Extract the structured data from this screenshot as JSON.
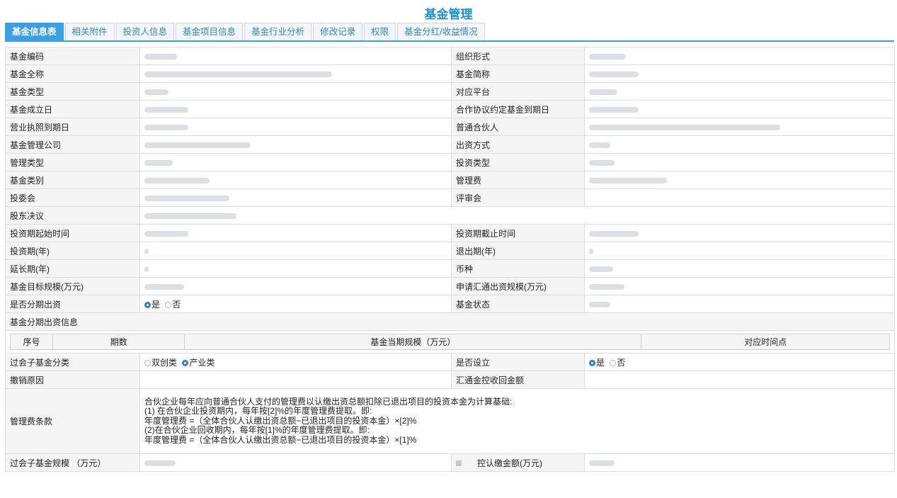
{
  "title": "基金管理",
  "tabs": [
    {
      "label": "基金信息表",
      "active": true
    },
    {
      "label": "相关附件"
    },
    {
      "label": "投资人信息"
    },
    {
      "label": "基金项目信息"
    },
    {
      "label": "基金行业分析"
    },
    {
      "label": "修改记录"
    },
    {
      "label": "权限"
    },
    {
      "label": "基金分红/收益情况"
    }
  ],
  "fields": {
    "fund_code": "基金编码",
    "org_form": "组织形式",
    "full_name": "基金全称",
    "short_name": "基金简称",
    "fund_type": "基金类型",
    "platform": "对应平台",
    "setup_date": "基金成立日",
    "agreement_expiry": "合作协议约定基金到期日",
    "license_expiry": "营业执照到期日",
    "gp": "普通合伙人",
    "manager": "基金管理公司",
    "contribution_method": "出资方式",
    "mgmt_type": "管理类型",
    "invest_type": "投资类型",
    "fund_category": "基金类别",
    "mgmt_fee": "管理费",
    "invest_committee": "投委会",
    "review_committee": "评审会",
    "shareholder_resolution": "股东决议",
    "invest_start": "投资期起始时间",
    "invest_end": "投资期截止时间",
    "invest_period": "投资期(年)",
    "exit_period": "退出期(年)",
    "extension_period": "延长期(年)",
    "currency": "币种",
    "target_scale": "基金目标规模(万元)",
    "apply_scale": "申请汇通出资规模(万元)",
    "installment": "是否分期出资",
    "fund_status": "基金状态",
    "installment_info": "基金分期出资信息",
    "sub_fund_class": "过会子基金分类",
    "is_established": "是否设立",
    "cancel_reason": "撤销原因",
    "recover_amount": "汇通金控收回金额",
    "fee_clause": "管理费条款",
    "sub_fund_scale": "过会子基金规模 （万元）",
    "confirmed_amount": "控认缴金额(万元)"
  },
  "radios": {
    "yes": "是",
    "no": "否",
    "dual": "双创类",
    "industry": "产业类"
  },
  "sub_table": {
    "headers": [
      "序号",
      "期数",
      "基金当期规模（万元）",
      "对应时间点"
    ]
  },
  "fee_clause_text": [
    "合伙企业每年应向普通合伙人支付的管理费以认缴出资总额扣除已退出项目的投资本金为计算基础:",
    "(1) 在合伙企业投资期内，每年按[2]%的年度管理费提取。即:",
    "年度管理费 =（全体合伙人认缴出资总额−已退出项目的投资本金）×[2]%",
    "(2)在合伙企业回收期内，每年按[1]%的年度管理费提取。即:",
    "年度管理费 =（全体合伙人认缴出资总额−已退出项目的投资本金）×[1]%"
  ],
  "colors": {
    "accent": "#3aa0e6",
    "title": "#1f8fd6",
    "label_bg": "#f5f5f5"
  }
}
